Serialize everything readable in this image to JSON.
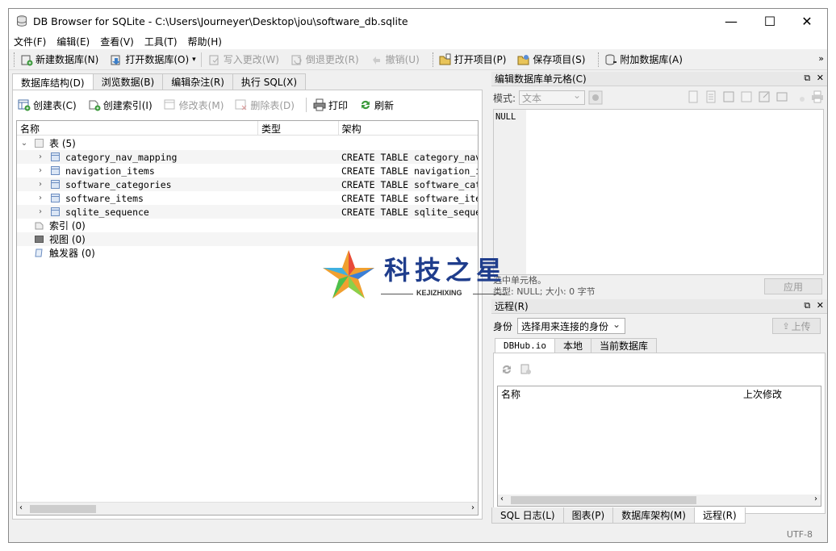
{
  "window": {
    "title": "DB Browser for SQLite - C:\\Users\\Journeyer\\Desktop\\jou\\software_db.sqlite"
  },
  "menu": [
    "文件(F)",
    "编辑(E)",
    "查看(V)",
    "工具(T)",
    "帮助(H)"
  ],
  "toolbar": {
    "new_db": "新建数据库(N)",
    "open_db": "打开数据库(O)",
    "write_changes": "写入更改(W)",
    "revert_changes": "倒退更改(R)",
    "undo": "撤销(U)",
    "open_project": "打开项目(P)",
    "save_project": "保存项目(S)",
    "attach_db": "附加数据库(A)",
    "overflow": "»"
  },
  "left_tabs": [
    "数据库结构(D)",
    "浏览数据(B)",
    "编辑杂注(R)",
    "执行 SQL(X)"
  ],
  "structure_toolbar": {
    "create_table": "创建表(C)",
    "create_index": "创建索引(I)",
    "modify_table": "修改表(M)",
    "delete_table": "删除表(D)",
    "print": "打印",
    "refresh": "刷新"
  },
  "tree": {
    "columns": [
      "名称",
      "类型",
      "架构"
    ],
    "tables_label": "表 (5)",
    "tables": [
      {
        "name": "category_nav_mapping",
        "schema": "CREATE TABLE category_nav"
      },
      {
        "name": "navigation_items",
        "schema": "CREATE TABLE navigation_i"
      },
      {
        "name": "software_categories",
        "schema": "CREATE TABLE software_cat"
      },
      {
        "name": "software_items",
        "schema": "CREATE TABLE software_ite"
      },
      {
        "name": "sqlite_sequence",
        "schema": "CREATE TABLE sqlite_seque"
      }
    ],
    "indexes_label": "索引 (0)",
    "views_label": "视图 (0)",
    "triggers_label": "触发器 (0)"
  },
  "edit_cell": {
    "title": "编辑数据库单元格(C)",
    "mode_label": "模式:",
    "mode_value": "文本",
    "content": "NULL",
    "status1": "选中单元格。",
    "status2": "类型: NULL; 大小: 0 字节",
    "apply": "应用"
  },
  "remote": {
    "title": "远程(R)",
    "identity_label": "身份",
    "identity_value": "选择用来连接的身份",
    "upload": "上传",
    "tabs": [
      "DBHub.io",
      "本地",
      "当前数据库"
    ],
    "columns": [
      "名称",
      "上次修改"
    ]
  },
  "bottom_tabs": [
    "SQL 日志(L)",
    "图表(P)",
    "数据库架构(M)",
    "远程(R)"
  ],
  "status": {
    "encoding": "UTF-8"
  },
  "watermark": {
    "title": "科技之星",
    "subtitle": "KEJIZHIXING"
  },
  "colors": {
    "accent": "#1f3d8c",
    "panel_bg": "#f0f0f0",
    "border": "#c8c8c8"
  }
}
